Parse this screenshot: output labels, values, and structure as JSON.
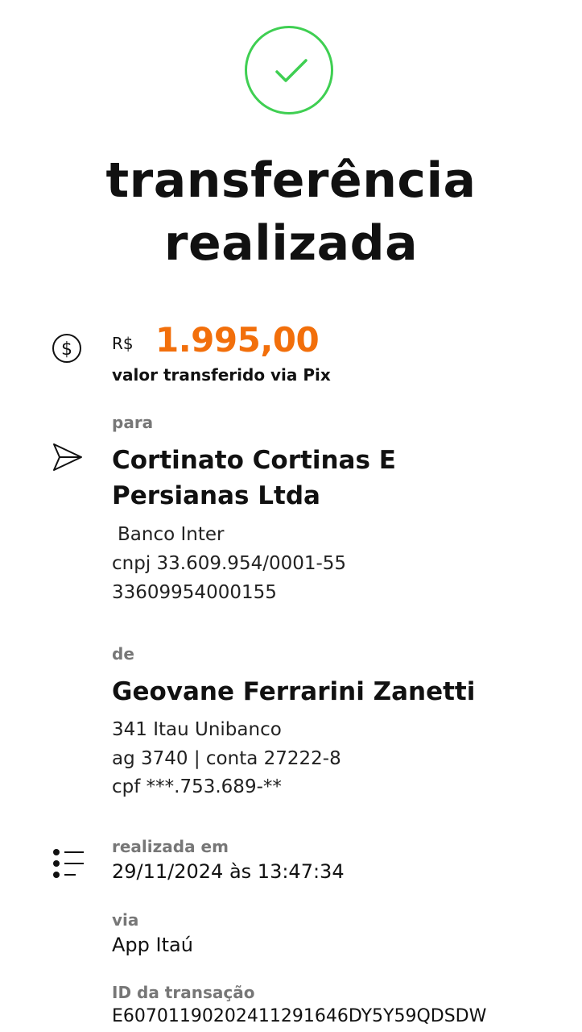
{
  "header": {
    "title_line1": "transferência",
    "title_line2": "realizada"
  },
  "icons": {
    "success": "check-circle-icon",
    "amount": "dollar-circle-icon",
    "recipient": "send-icon",
    "details": "list-icon",
    "success_color": "#3fcf52",
    "amount_color": "#f26f0b"
  },
  "amount": {
    "currency": "R$",
    "value": "1.995,00",
    "caption": "valor transferido via Pix"
  },
  "recipient": {
    "label": "para",
    "name_line1": "Cortinato Cortinas E",
    "name_line2": "Persianas Ltda",
    "bank": "Banco Inter",
    "cnpj": "cnpj 33.609.954/0001-55",
    "key": "33609954000155"
  },
  "sender": {
    "label": "de",
    "name": "Geovane Ferrarini Zanetti",
    "bank": "341 Itau Unibanco",
    "account": "ag 3740 | conta 27222-8",
    "cpf": "cpf ***.753.689-**"
  },
  "details": {
    "date_label": "realizada em",
    "date_value": "29/11/2024 às 13:47:34",
    "via_label": "via",
    "via_value": "App Itaú",
    "id_label": "ID da transação",
    "id_value": "E60701190202411291646DY5Y59QDSDW"
  }
}
